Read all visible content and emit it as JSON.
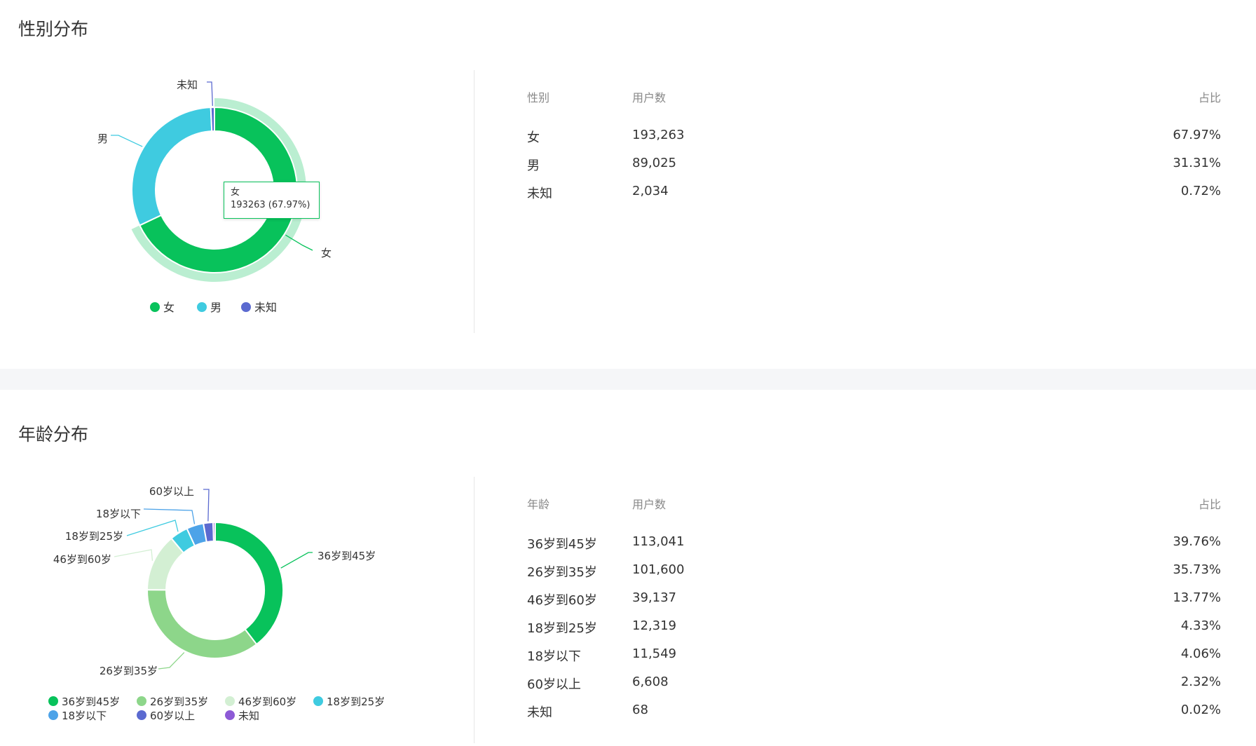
{
  "gender": {
    "title": "性别分布",
    "table": {
      "headers": [
        "性别",
        "用户数",
        "占比"
      ],
      "rows": [
        {
          "label": "女",
          "count": "193,263",
          "pct": "67.97%"
        },
        {
          "label": "男",
          "count": "89,025",
          "pct": "31.31%"
        },
        {
          "label": "未知",
          "count": "2,034",
          "pct": "0.72%"
        }
      ]
    },
    "tooltip": {
      "name": "女",
      "value": "193263 (67.97%)"
    }
  },
  "age": {
    "title": "年龄分布",
    "table": {
      "headers": [
        "年龄",
        "用户数",
        "占比"
      ],
      "rows": [
        {
          "label": "36岁到45岁",
          "count": "113,041",
          "pct": "39.76%"
        },
        {
          "label": "26岁到35岁",
          "count": "101,600",
          "pct": "35.73%"
        },
        {
          "label": "46岁到60岁",
          "count": "39,137",
          "pct": "13.77%"
        },
        {
          "label": "18岁到25岁",
          "count": "12,319",
          "pct": "4.33%"
        },
        {
          "label": "18岁以下",
          "count": "11,549",
          "pct": "4.06%"
        },
        {
          "label": "60岁以上",
          "count": "6,608",
          "pct": "2.32%"
        },
        {
          "label": "未知",
          "count": "68",
          "pct": "0.02%"
        }
      ]
    }
  },
  "chart_data": [
    {
      "type": "pie",
      "variant": "donut",
      "highlighted": "女",
      "legend_position": "bottom",
      "slices": [
        {
          "name": "女",
          "value": 193263,
          "color": "#08c25b"
        },
        {
          "name": "男",
          "value": 89025,
          "color": "#3fcbe0"
        },
        {
          "name": "未知",
          "value": 2034,
          "color": "#5b6ad0"
        }
      ]
    },
    {
      "type": "pie",
      "variant": "donut",
      "legend_position": "bottom",
      "slices": [
        {
          "name": "36岁到45岁",
          "value": 113041,
          "color": "#08c25b"
        },
        {
          "name": "26岁到35岁",
          "value": 101600,
          "color": "#8dd68a"
        },
        {
          "name": "46岁到60岁",
          "value": 39137,
          "color": "#d3efd3"
        },
        {
          "name": "18岁到25岁",
          "value": 12319,
          "color": "#3fcbe0"
        },
        {
          "name": "18岁以下",
          "value": 11549,
          "color": "#4da3e8"
        },
        {
          "name": "60岁以上",
          "value": 6608,
          "color": "#5b6ad0"
        },
        {
          "name": "未知",
          "value": 68,
          "color": "#8d5ad6"
        }
      ]
    }
  ]
}
